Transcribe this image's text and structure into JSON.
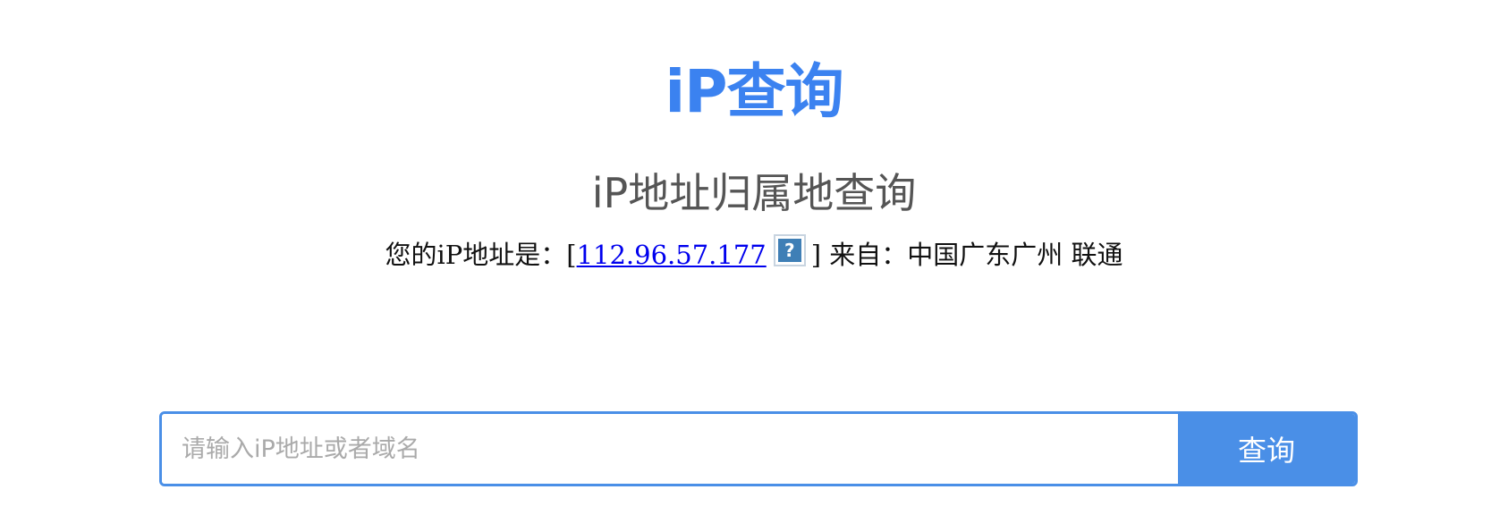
{
  "logo": {
    "text": "iP查询",
    "color": "#3b82f0"
  },
  "title": "iP地址归属地查询",
  "ip_info": {
    "prefix": "您的iP地址是：[",
    "ip": "112.96.57.177",
    "help_icon_label": "?",
    "help_icon": "question-icon",
    "suffix": "] 来自：中国广东广州 联通"
  },
  "search": {
    "placeholder": "请输入iP地址或者域名",
    "value": "",
    "button_label": "查询"
  },
  "colors": {
    "accent": "#4a8fe7",
    "title": "#555555",
    "link": "#0000ee"
  }
}
